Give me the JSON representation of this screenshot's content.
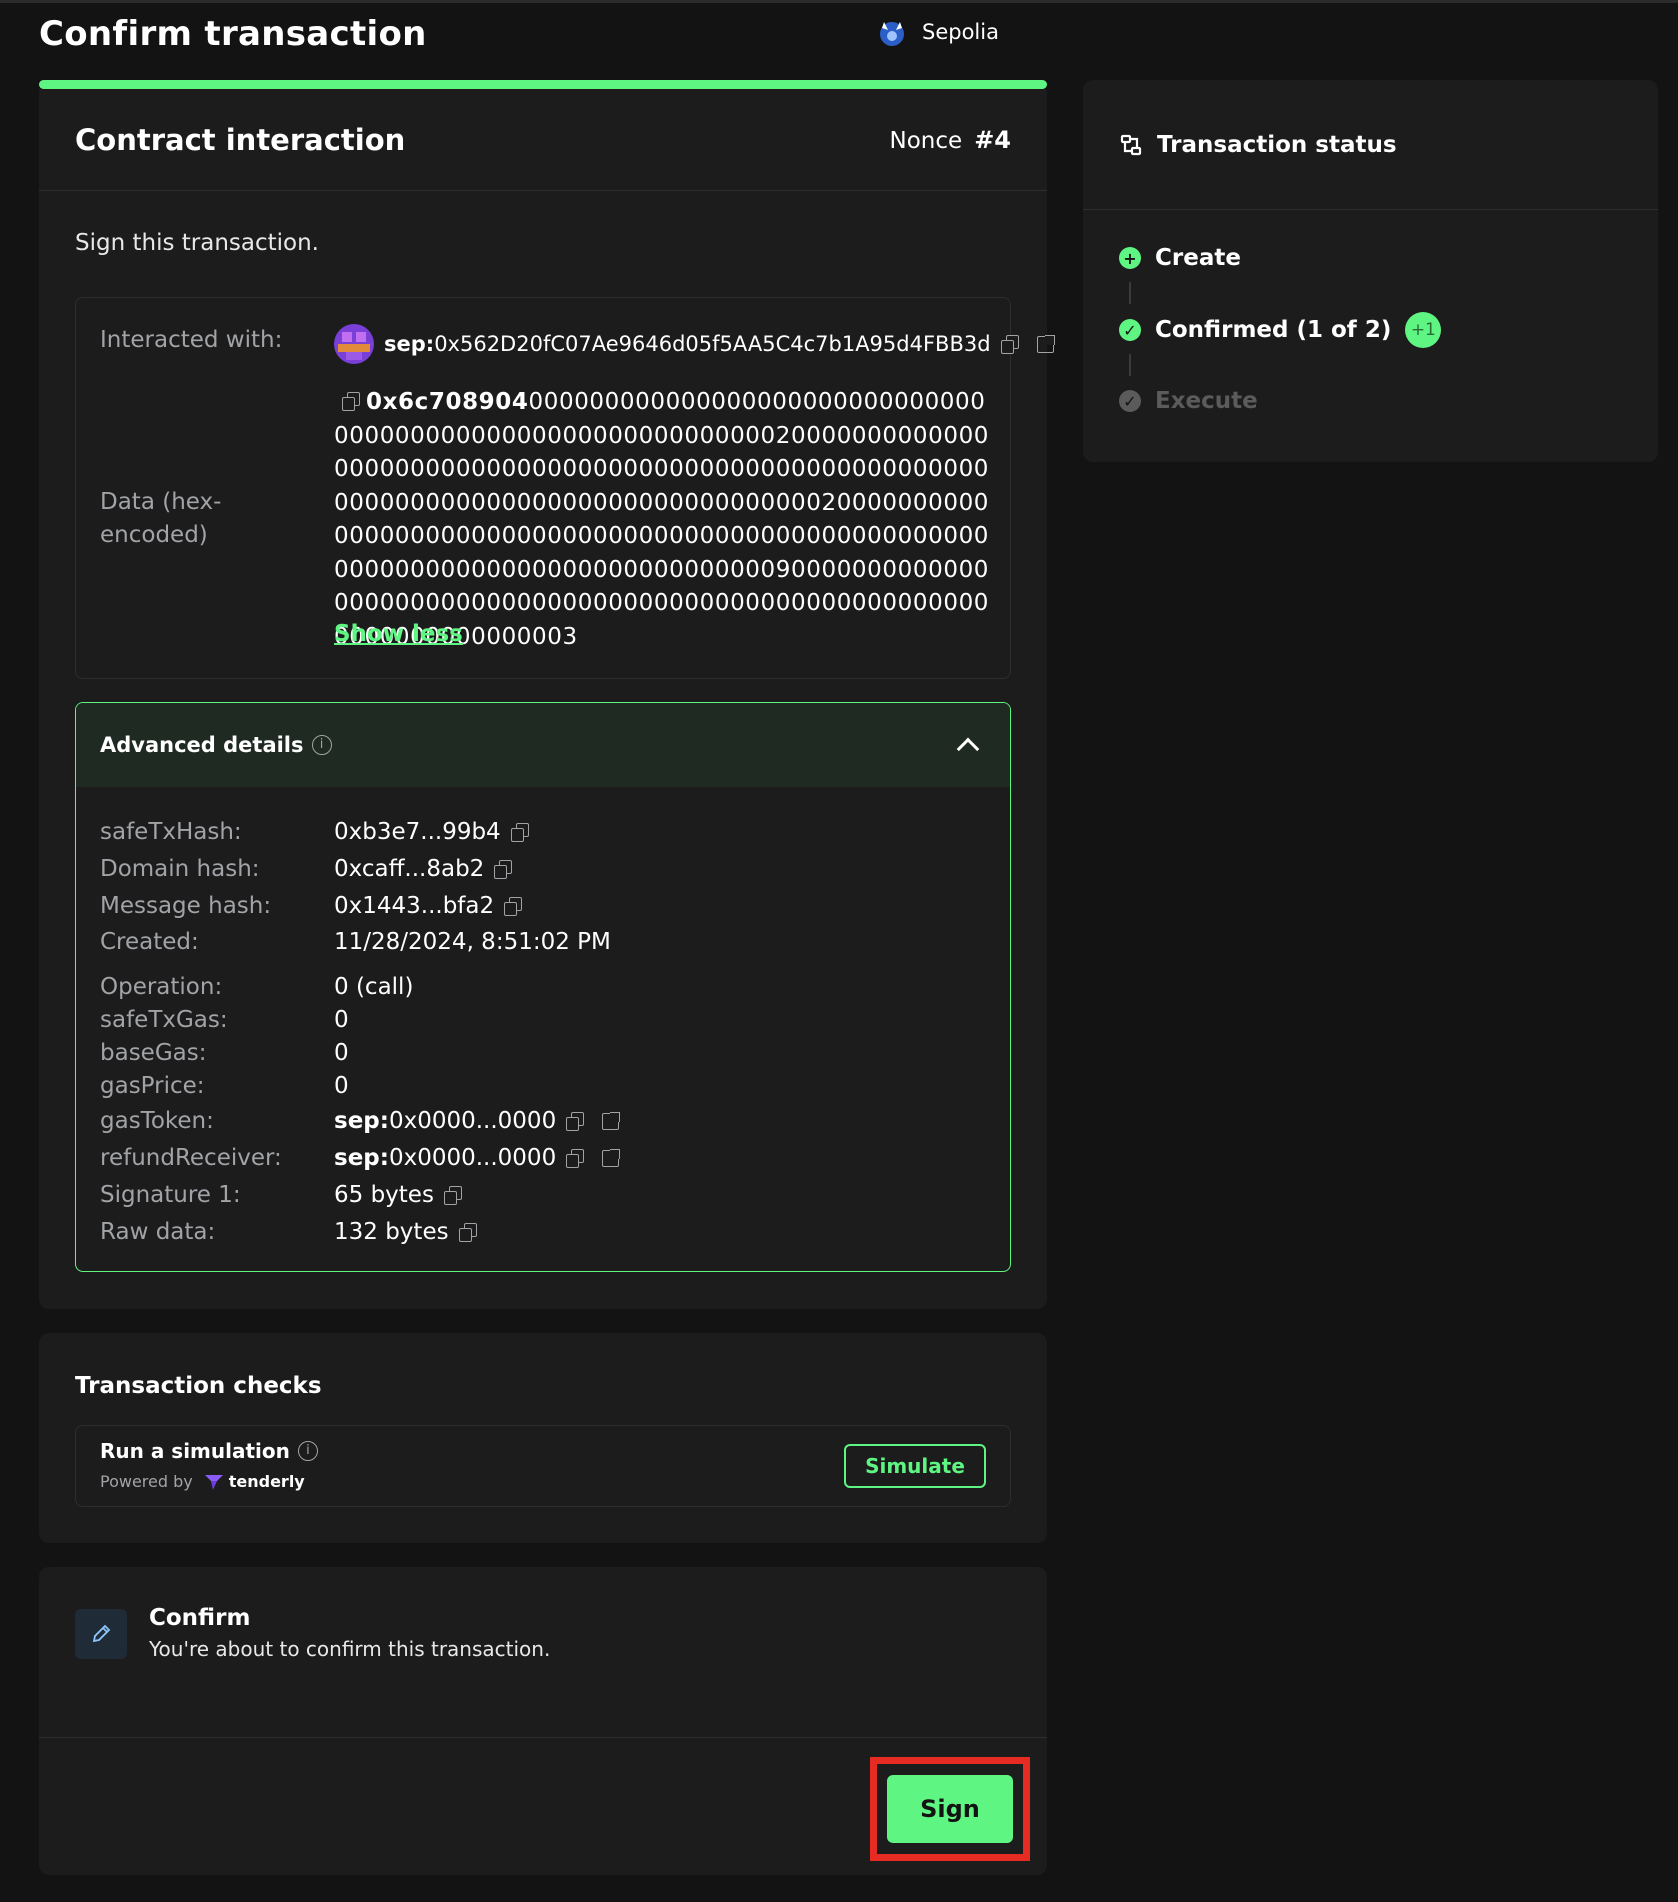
{
  "header": {
    "title": "Confirm transaction",
    "network": "Sepolia"
  },
  "tx": {
    "type_title": "Contract interaction",
    "nonce_label": "Nonce",
    "nonce_value": "#4",
    "instruction": "Sign this transaction.",
    "interacted_label": "Interacted with:",
    "interacted_prefix": "sep:",
    "interacted_address": "0x562D20fC07Ae9646d05f5AA5C4c7b1A95d4FBB3d",
    "data_label": "Data (hex-encoded)",
    "data_selector": "0x6c708904",
    "data_rest": "0000000000000000000000000000000000000000000000000000000000020000000000000000000000000000000000000000000000000000000000000000000000000000000000000000200000000000000000000000000000000000000000000000000000000000000000000000000000000009000000000000000000000000000000000000000000000000000000000000000000000003",
    "show_less": "Show less"
  },
  "advanced": {
    "title": "Advanced details",
    "rows": [
      {
        "key": "safeTxHash:",
        "prefix": "",
        "value": "0xb3e7...99b4",
        "copy": true,
        "ext": false
      },
      {
        "key": "Domain hash:",
        "prefix": "",
        "value": "0xcaff...8ab2",
        "copy": true,
        "ext": false
      },
      {
        "key": "Message hash:",
        "prefix": "",
        "value": "0x1443...bfa2",
        "copy": true,
        "ext": false
      },
      {
        "key": "Created:",
        "prefix": "",
        "value": "11/28/2024, 8:51:02 PM",
        "copy": false,
        "ext": false
      },
      {
        "key": "Operation:",
        "prefix": "",
        "value": "0 (call)",
        "copy": false,
        "ext": false
      },
      {
        "key": "safeTxGas:",
        "prefix": "",
        "value": "0",
        "copy": false,
        "ext": false
      },
      {
        "key": "baseGas:",
        "prefix": "",
        "value": "0",
        "copy": false,
        "ext": false
      },
      {
        "key": "gasPrice:",
        "prefix": "",
        "value": "0",
        "copy": false,
        "ext": false
      },
      {
        "key": "gasToken:",
        "prefix": "sep:",
        "value": "0x0000...0000",
        "copy": true,
        "ext": true
      },
      {
        "key": "refundReceiver:",
        "prefix": "sep:",
        "value": "0x0000...0000",
        "copy": true,
        "ext": true
      },
      {
        "key": "Signature 1:",
        "prefix": "",
        "value": "65 bytes",
        "copy": true,
        "ext": false
      },
      {
        "key": "Raw data:",
        "prefix": "",
        "value": "132 bytes",
        "copy": true,
        "ext": false
      }
    ]
  },
  "checks": {
    "title": "Transaction checks",
    "sim_title": "Run a simulation",
    "powered_by": "Powered by",
    "provider": "tenderly",
    "simulate_label": "Simulate"
  },
  "confirm": {
    "title": "Confirm",
    "subtitle": "You're about to confirm this transaction.",
    "sign_label": "Sign"
  },
  "status": {
    "title": "Transaction status",
    "steps": [
      {
        "label": "Create",
        "state": "done"
      },
      {
        "label": "Confirmed (1 of 2)",
        "state": "done"
      },
      {
        "label": "Execute",
        "state": "pending"
      }
    ],
    "badge": "+1"
  },
  "colors": {
    "accent": "#5ff582",
    "background": "#121312",
    "card": "#1c1c1c",
    "highlight": "#e62b22"
  }
}
